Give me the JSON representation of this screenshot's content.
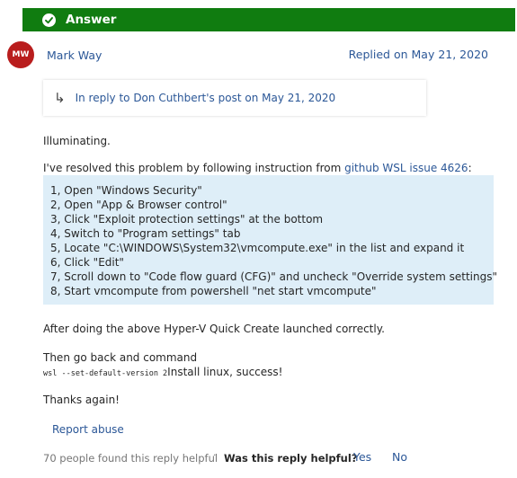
{
  "answer": {
    "label": "Answer",
    "color": "#107c10"
  },
  "post": {
    "author_initials": "MW",
    "author_name": "Mark Way",
    "avatar_color": "#b91d1d",
    "replied_on": "Replied on May 21, 2020",
    "in_reply_to": "In reply to Don Cuthbert's post on May 21, 2020",
    "intro": "Illuminating.",
    "resolved_prefix": "I've resolved this problem by following instruction from ",
    "resolved_link": "github WSL issue 4626",
    "resolved_suffix": ":",
    "steps": [
      "1, Open \"Windows Security\"",
      "2, Open \"App & Browser control\"",
      "3, Click \"Exploit protection settings\" at the bottom",
      "4, Switch to \"Program settings\" tab",
      "5, Locate \"C:\\WINDOWS\\System32\\vmcompute.exe\" in the list and expand it",
      "6, Click \"Edit\"",
      "7, Scroll down to \"Code flow guard (CFG)\" and uncheck \"Override system settings\"",
      "8, Start vmcompute from powershell \"net start vmcompute\""
    ],
    "after_text": "After doing the above Hyper-V Quick Create launched correctly.",
    "then_text": "Then go back and command",
    "command": "wsl --set-default-version 2",
    "command_suffix": "Install linux, success!",
    "thanks": "Thanks again!"
  },
  "footer": {
    "report_abuse": "Report abuse",
    "helpful_count": "70 people found this reply helpful",
    "separator": "·",
    "helpful_question": "Was this reply helpful?",
    "yes": "Yes",
    "no": "No"
  },
  "colors": {
    "link": "#2b5797",
    "steps_background": "#deeef8"
  }
}
